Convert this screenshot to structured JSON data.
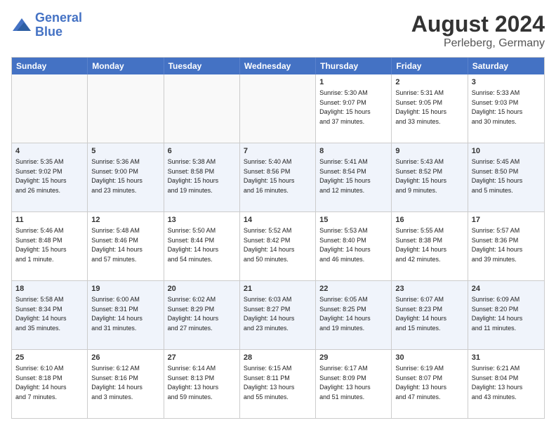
{
  "header": {
    "logo_general": "General",
    "logo_blue": "Blue",
    "month_year": "August 2024",
    "location": "Perleberg, Germany"
  },
  "days_of_week": [
    "Sunday",
    "Monday",
    "Tuesday",
    "Wednesday",
    "Thursday",
    "Friday",
    "Saturday"
  ],
  "rows": [
    {
      "alt": false,
      "cells": [
        {
          "day": "",
          "text": ""
        },
        {
          "day": "",
          "text": ""
        },
        {
          "day": "",
          "text": ""
        },
        {
          "day": "",
          "text": ""
        },
        {
          "day": "1",
          "text": "Sunrise: 5:30 AM\nSunset: 9:07 PM\nDaylight: 15 hours\nand 37 minutes."
        },
        {
          "day": "2",
          "text": "Sunrise: 5:31 AM\nSunset: 9:05 PM\nDaylight: 15 hours\nand 33 minutes."
        },
        {
          "day": "3",
          "text": "Sunrise: 5:33 AM\nSunset: 9:03 PM\nDaylight: 15 hours\nand 30 minutes."
        }
      ]
    },
    {
      "alt": true,
      "cells": [
        {
          "day": "4",
          "text": "Sunrise: 5:35 AM\nSunset: 9:02 PM\nDaylight: 15 hours\nand 26 minutes."
        },
        {
          "day": "5",
          "text": "Sunrise: 5:36 AM\nSunset: 9:00 PM\nDaylight: 15 hours\nand 23 minutes."
        },
        {
          "day": "6",
          "text": "Sunrise: 5:38 AM\nSunset: 8:58 PM\nDaylight: 15 hours\nand 19 minutes."
        },
        {
          "day": "7",
          "text": "Sunrise: 5:40 AM\nSunset: 8:56 PM\nDaylight: 15 hours\nand 16 minutes."
        },
        {
          "day": "8",
          "text": "Sunrise: 5:41 AM\nSunset: 8:54 PM\nDaylight: 15 hours\nand 12 minutes."
        },
        {
          "day": "9",
          "text": "Sunrise: 5:43 AM\nSunset: 8:52 PM\nDaylight: 15 hours\nand 9 minutes."
        },
        {
          "day": "10",
          "text": "Sunrise: 5:45 AM\nSunset: 8:50 PM\nDaylight: 15 hours\nand 5 minutes."
        }
      ]
    },
    {
      "alt": false,
      "cells": [
        {
          "day": "11",
          "text": "Sunrise: 5:46 AM\nSunset: 8:48 PM\nDaylight: 15 hours\nand 1 minute."
        },
        {
          "day": "12",
          "text": "Sunrise: 5:48 AM\nSunset: 8:46 PM\nDaylight: 14 hours\nand 57 minutes."
        },
        {
          "day": "13",
          "text": "Sunrise: 5:50 AM\nSunset: 8:44 PM\nDaylight: 14 hours\nand 54 minutes."
        },
        {
          "day": "14",
          "text": "Sunrise: 5:52 AM\nSunset: 8:42 PM\nDaylight: 14 hours\nand 50 minutes."
        },
        {
          "day": "15",
          "text": "Sunrise: 5:53 AM\nSunset: 8:40 PM\nDaylight: 14 hours\nand 46 minutes."
        },
        {
          "day": "16",
          "text": "Sunrise: 5:55 AM\nSunset: 8:38 PM\nDaylight: 14 hours\nand 42 minutes."
        },
        {
          "day": "17",
          "text": "Sunrise: 5:57 AM\nSunset: 8:36 PM\nDaylight: 14 hours\nand 39 minutes."
        }
      ]
    },
    {
      "alt": true,
      "cells": [
        {
          "day": "18",
          "text": "Sunrise: 5:58 AM\nSunset: 8:34 PM\nDaylight: 14 hours\nand 35 minutes."
        },
        {
          "day": "19",
          "text": "Sunrise: 6:00 AM\nSunset: 8:31 PM\nDaylight: 14 hours\nand 31 minutes."
        },
        {
          "day": "20",
          "text": "Sunrise: 6:02 AM\nSunset: 8:29 PM\nDaylight: 14 hours\nand 27 minutes."
        },
        {
          "day": "21",
          "text": "Sunrise: 6:03 AM\nSunset: 8:27 PM\nDaylight: 14 hours\nand 23 minutes."
        },
        {
          "day": "22",
          "text": "Sunrise: 6:05 AM\nSunset: 8:25 PM\nDaylight: 14 hours\nand 19 minutes."
        },
        {
          "day": "23",
          "text": "Sunrise: 6:07 AM\nSunset: 8:23 PM\nDaylight: 14 hours\nand 15 minutes."
        },
        {
          "day": "24",
          "text": "Sunrise: 6:09 AM\nSunset: 8:20 PM\nDaylight: 14 hours\nand 11 minutes."
        }
      ]
    },
    {
      "alt": false,
      "cells": [
        {
          "day": "25",
          "text": "Sunrise: 6:10 AM\nSunset: 8:18 PM\nDaylight: 14 hours\nand 7 minutes."
        },
        {
          "day": "26",
          "text": "Sunrise: 6:12 AM\nSunset: 8:16 PM\nDaylight: 14 hours\nand 3 minutes."
        },
        {
          "day": "27",
          "text": "Sunrise: 6:14 AM\nSunset: 8:13 PM\nDaylight: 13 hours\nand 59 minutes."
        },
        {
          "day": "28",
          "text": "Sunrise: 6:15 AM\nSunset: 8:11 PM\nDaylight: 13 hours\nand 55 minutes."
        },
        {
          "day": "29",
          "text": "Sunrise: 6:17 AM\nSunset: 8:09 PM\nDaylight: 13 hours\nand 51 minutes."
        },
        {
          "day": "30",
          "text": "Sunrise: 6:19 AM\nSunset: 8:07 PM\nDaylight: 13 hours\nand 47 minutes."
        },
        {
          "day": "31",
          "text": "Sunrise: 6:21 AM\nSunset: 8:04 PM\nDaylight: 13 hours\nand 43 minutes."
        }
      ]
    }
  ]
}
